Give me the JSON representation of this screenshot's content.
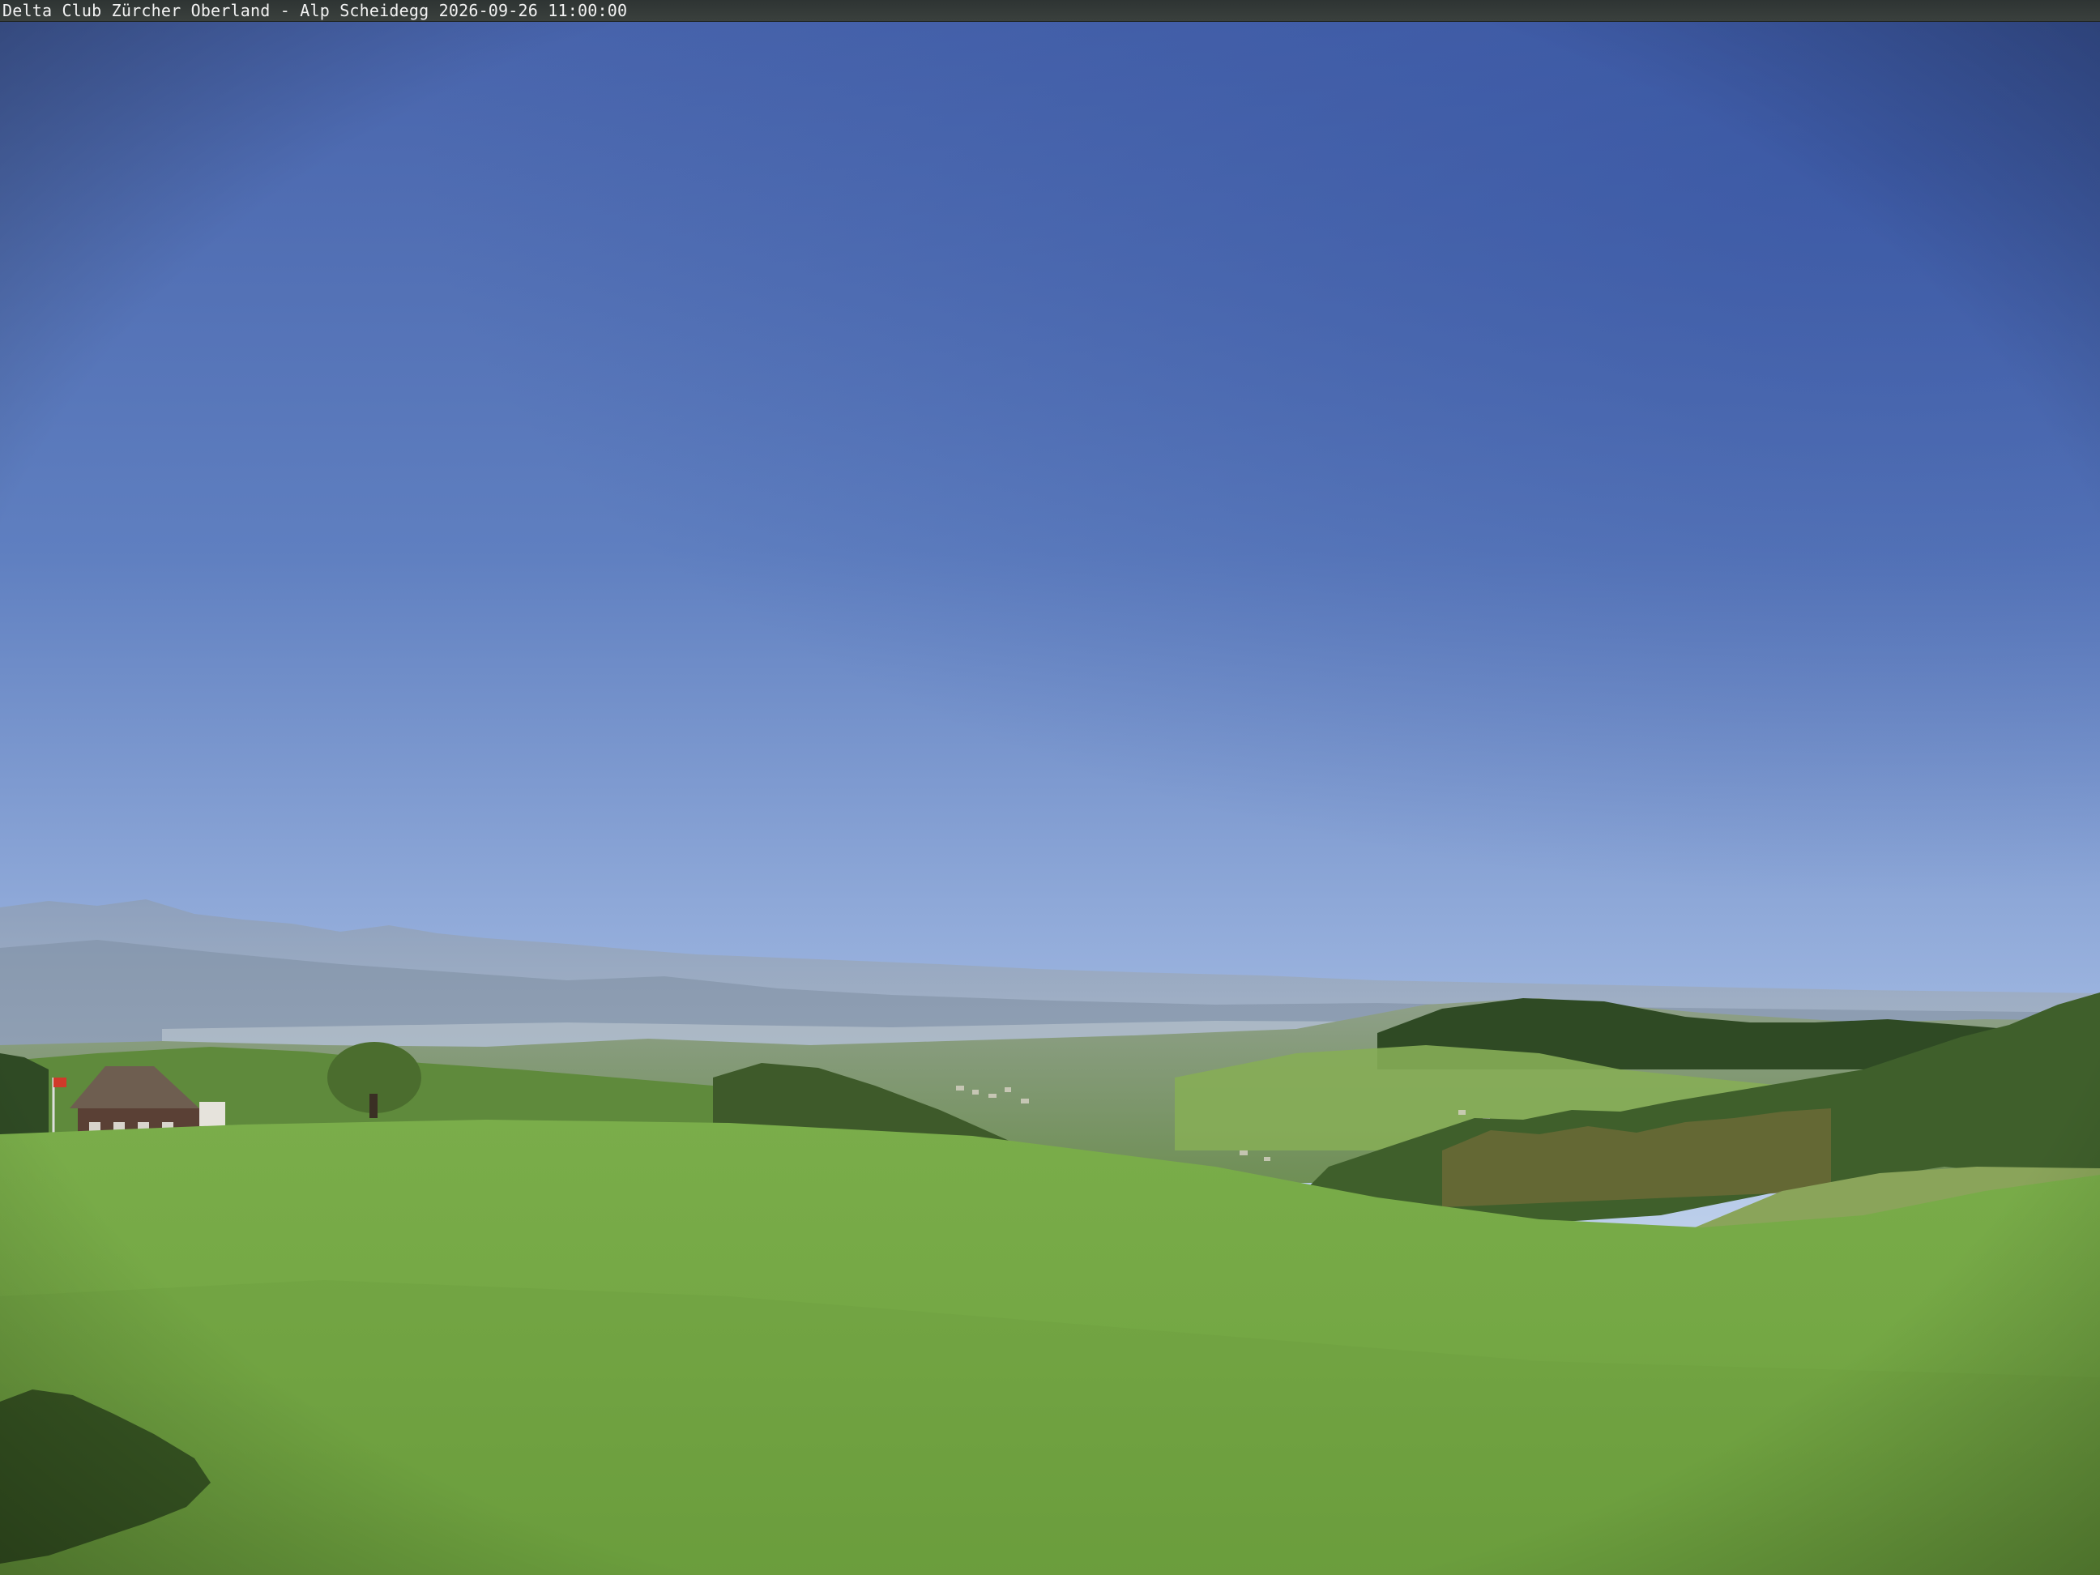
{
  "caption": {
    "text": "Delta Club Zürcher Oberland - Alp Scheidegg 2026-09-26 11:00:00"
  },
  "scene": {
    "sky": "clear blue sky, deeper blue at top-right, pale near horizon",
    "mountains": "hazy alpine range along the left horizon",
    "valley": "green hills, forests, villages in the mid-ground valley",
    "foreground": "grassy meadow slope with shadow of a tree at bottom-left",
    "buildings": "farmhouse with flags at the left edge",
    "colors": {
      "sky_top": "#3c5da4",
      "sky_mid": "#6f8fc8",
      "sky_horizon": "#dde8f4",
      "meadow": "#79a947",
      "meadow_dark": "#5f8f34",
      "forest": "#2f4a22",
      "mountain_haze": "#9aa9bd"
    }
  }
}
